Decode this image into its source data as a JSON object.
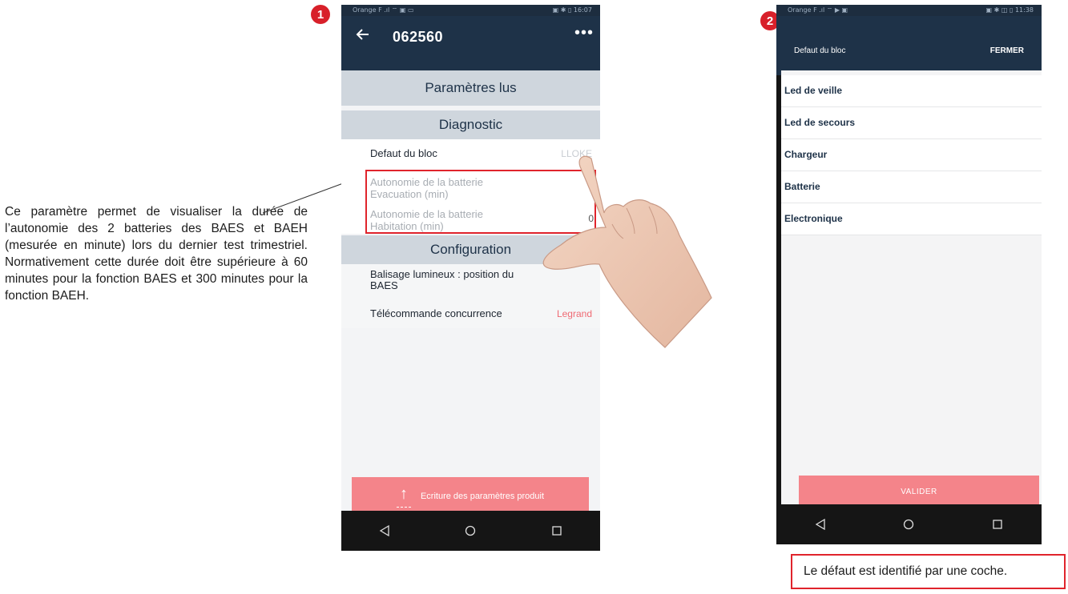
{
  "annotation": {
    "text": "Ce paramètre permet de visualiser la durée de l’autonomie des 2 batteries des BAES et BAEH (mesurée en minute) lors du dernier test trimestriel. Normativement cette durée doit être supérieure à 60 minutes pour la fonction BAES et 300 minutes pour la fonction BAEH."
  },
  "badges": {
    "step1": "1",
    "step2": "2"
  },
  "phone1": {
    "status_left": "Orange F  .ıl ⌔ ▣ ▭",
    "status_right": "▣ ✱ ▯ 16:07",
    "title": "062560",
    "more": "•••",
    "section_read": "Paramètres lus",
    "section_diag": "Diagnostic",
    "defaut_label": "Defaut du bloc",
    "defaut_value": "LLOKE",
    "autonomie_evac": "Autonomie de la batterie Evacuation (min)",
    "autonomie_hab": "Autonomie de la batterie Habitation (min)",
    "autonomie_hab_value": "0",
    "section_config": "Configuration",
    "balisage": "Balisage lumineux : position du BAES",
    "telecommande": "Télécommande concurrence",
    "telecommande_value": "Legrand",
    "write_button": "Ecriture des paramètres produit"
  },
  "phone2": {
    "status_left": "Orange F  .ıl ⌔ ▶ ▣",
    "status_right": "▣ ✱ ◫ ▯ 11:38",
    "title": "Defaut du bloc",
    "close": "FERMER",
    "items": [
      {
        "label": "Led de veille"
      },
      {
        "label": "Led de secours"
      },
      {
        "label": "Chargeur"
      },
      {
        "label": "Batterie"
      },
      {
        "label": "Electronique"
      }
    ],
    "validate": "VALIDER"
  },
  "note": {
    "text": "Le défaut est identifié par une coche."
  },
  "colors": {
    "accent_red": "#e0242c",
    "app_bar": "#1e3248",
    "button_pink": "#f4848a",
    "section_grey": "#cfd6dd"
  }
}
